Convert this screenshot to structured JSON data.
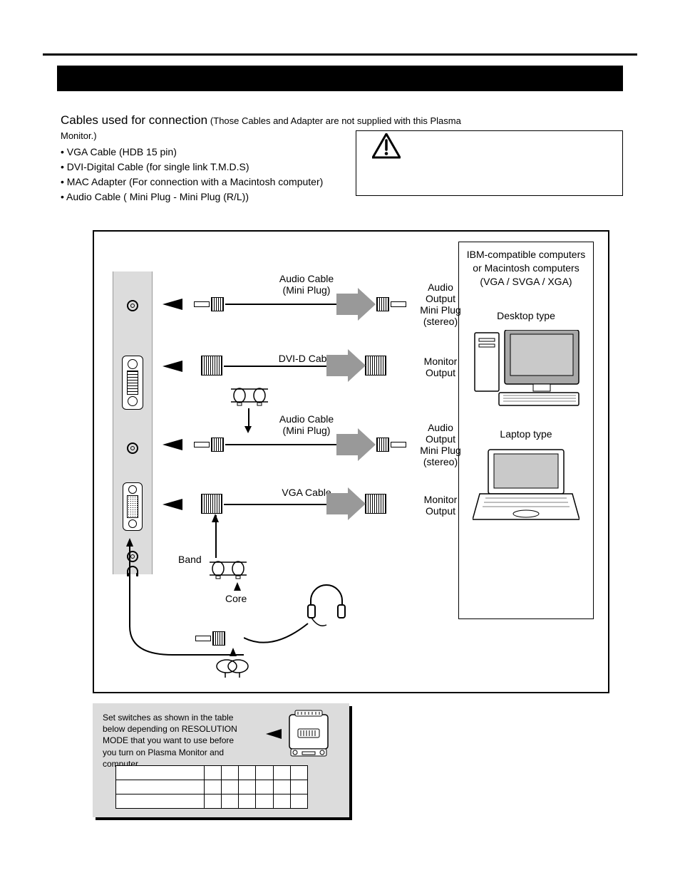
{
  "intro": {
    "lead": "Cables used for connection",
    "note": "(Those Cables and Adapter are not supplied with this Plasma Monitor.)",
    "bullets": [
      "• VGA Cable (HDB 15 pin)",
      "• DVI-Digital Cable (for single link T.M.D.S)",
      "• MAC Adapter (For connection with a Macintosh computer)",
      "• Audio Cable ( Mini Plug - Mini Plug (R/L))"
    ]
  },
  "pc_box": {
    "head_line1": "IBM-compatible computers",
    "head_line2": "or Macintosh computers",
    "head_line3": "(VGA / SVGA / XGA)",
    "desktop": "Desktop type",
    "laptop": "Laptop type"
  },
  "cables": {
    "audio1": {
      "label1": "Audio Cable",
      "label2": "(Mini Plug)",
      "out1": "Audio",
      "out2": "Output",
      "out3": "Mini Plug",
      "out4": "(stereo)"
    },
    "dvi": {
      "label": "DVI-D Cable",
      "out1": "Monitor",
      "out2": "Output"
    },
    "audio2": {
      "label1": "Audio Cable",
      "label2": "(Mini Plug)",
      "out1": "Audio",
      "out2": "Output",
      "out3": "Mini Plug",
      "out4": "(stereo)"
    },
    "vga": {
      "label": "VGA Cable",
      "out1": "Monitor",
      "out2": "Output"
    }
  },
  "tiny": {
    "band": "Band",
    "core": "Core"
  },
  "switchbox": {
    "text": "Set switches as shown in the table below depending on RESOLUTION MODE that you want to use before you turn on Plasma Monitor and computer."
  }
}
